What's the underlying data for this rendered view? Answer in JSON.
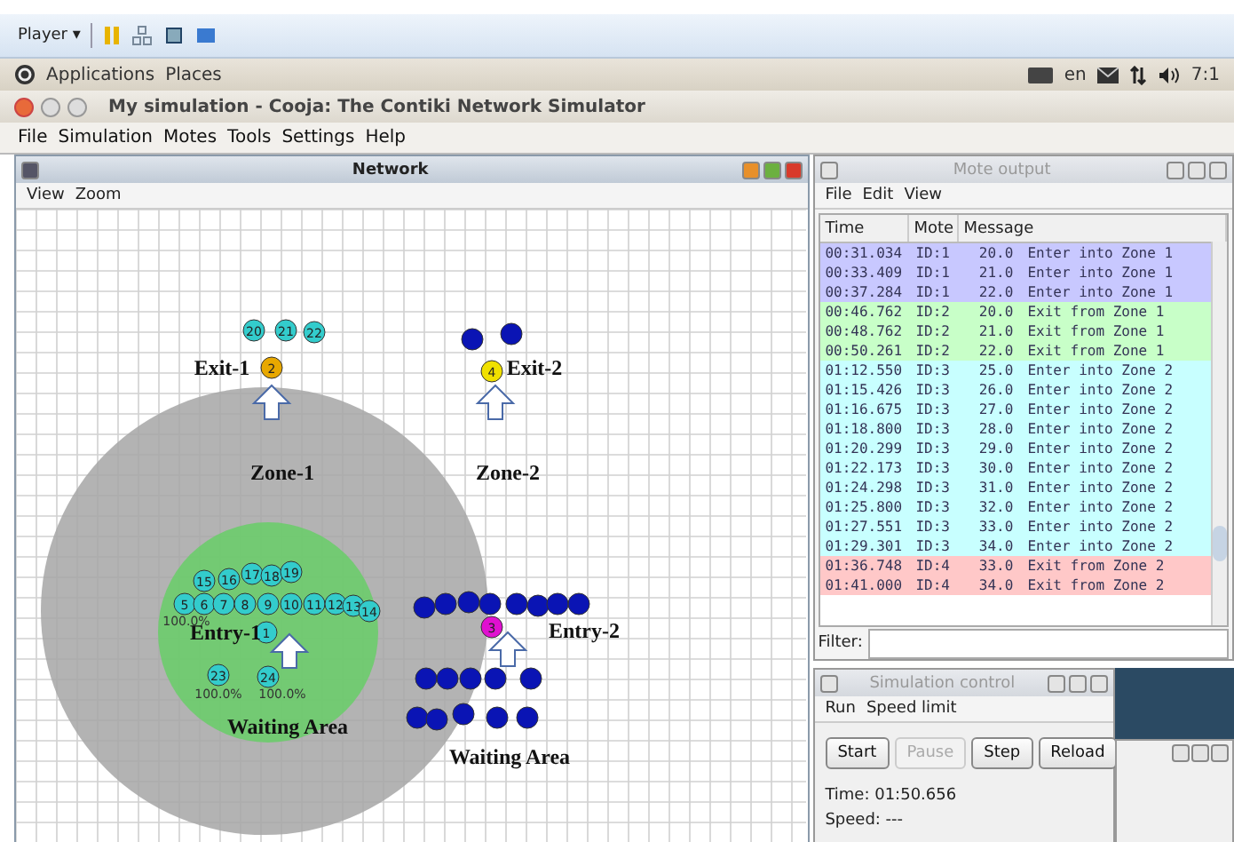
{
  "player_bar": {
    "label": "Player",
    "caret": "▾"
  },
  "panel": {
    "menus": [
      "Applications",
      "Places"
    ],
    "language": "en",
    "clock": "7:1"
  },
  "window": {
    "title": "My simulation - Cooja: The Contiki Network Simulator"
  },
  "menu": [
    "File",
    "Simulation",
    "Motes",
    "Tools",
    "Settings",
    "Help"
  ],
  "network": {
    "title": "Network",
    "menu": [
      "View",
      "Zoom"
    ],
    "motes": [
      {
        "label": "20",
        "color": "#33cccc"
      },
      {
        "label": "21",
        "color": "#33cccc"
      },
      {
        "label": "22",
        "color": "#33cccc"
      },
      {
        "label": "2",
        "color": "#e8a800"
      },
      {
        "color": "#0a14b4"
      },
      {
        "color": "#0a14b4"
      },
      {
        "label": "4",
        "color": "#f0e000"
      },
      {
        "label": "15",
        "color": "#33cccc"
      },
      {
        "label": "16",
        "color": "#33cccc"
      },
      {
        "label": "17",
        "color": "#33cccc"
      },
      {
        "label": "18",
        "color": "#33cccc"
      },
      {
        "label": "19",
        "color": "#33cccc"
      },
      {
        "label": "5",
        "color": "#33cccc"
      },
      {
        "label": "6",
        "color": "#33cccc"
      },
      {
        "label": "7",
        "color": "#33cccc"
      },
      {
        "label": "8",
        "color": "#33cccc"
      },
      {
        "label": "9",
        "color": "#33cccc"
      },
      {
        "label": "10",
        "color": "#33cccc"
      },
      {
        "label": "11",
        "color": "#33cccc"
      },
      {
        "label": "12",
        "color": "#33cccc"
      },
      {
        "label": "13",
        "color": "#33cccc"
      },
      {
        "label": "14",
        "color": "#33cccc"
      },
      {
        "label": "1",
        "color": "#33cccc"
      },
      {
        "label": "23",
        "color": "#33cccc"
      },
      {
        "label": "24",
        "color": "#33cccc"
      },
      {
        "color": "#0a14b4"
      },
      {
        "color": "#0a14b4"
      },
      {
        "color": "#0a14b4"
      },
      {
        "color": "#0a14b4"
      },
      {
        "color": "#0a14b4"
      },
      {
        "color": "#0a14b4"
      },
      {
        "color": "#0a14b4"
      },
      {
        "color": "#0a14b4"
      },
      {
        "label": "3",
        "color": "#e010d0"
      },
      {
        "color": "#0a14b4"
      },
      {
        "color": "#0a14b4"
      },
      {
        "color": "#0a14b4"
      },
      {
        "color": "#0a14b4"
      },
      {
        "color": "#0a14b4"
      },
      {
        "color": "#0a14b4"
      },
      {
        "color": "#0a14b4"
      },
      {
        "color": "#0a14b4"
      },
      {
        "color": "#0a14b4"
      },
      {
        "color": "#0a14b4"
      }
    ],
    "labels": [
      "Exit-1",
      "Exit-2",
      "Zone-1",
      "Zone-2",
      "Entry-1",
      "Entry-2",
      "Waiting Area",
      "Waiting Area"
    ],
    "readings": [
      "100.0%",
      "100.0%",
      "100.0%"
    ]
  },
  "mote_output": {
    "title": "Mote output",
    "menu": [
      "File",
      "Edit",
      "View"
    ],
    "columns": [
      "Time",
      "Mote",
      "Message"
    ],
    "rows": [
      {
        "time": "00:31.034",
        "mote": "ID:1",
        "value": "20.0",
        "message": "Enter into Zone 1",
        "color": "#c8c8ff"
      },
      {
        "time": "00:33.409",
        "mote": "ID:1",
        "value": "21.0",
        "message": "Enter into Zone 1",
        "color": "#c8c8ff"
      },
      {
        "time": "00:37.284",
        "mote": "ID:1",
        "value": "22.0",
        "message": "Enter into Zone 1",
        "color": "#c8c8ff"
      },
      {
        "time": "00:46.762",
        "mote": "ID:2",
        "value": "20.0",
        "message": "Exit from Zone 1",
        "color": "#c8ffc8"
      },
      {
        "time": "00:48.762",
        "mote": "ID:2",
        "value": "21.0",
        "message": "Exit from Zone 1",
        "color": "#c8ffc8"
      },
      {
        "time": "00:50.261",
        "mote": "ID:2",
        "value": "22.0",
        "message": "Exit from Zone 1",
        "color": "#c8ffc8"
      },
      {
        "time": "01:12.550",
        "mote": "ID:3",
        "value": "25.0",
        "message": "Enter into Zone 2",
        "color": "#c8ffff"
      },
      {
        "time": "01:15.426",
        "mote": "ID:3",
        "value": "26.0",
        "message": "Enter into Zone 2",
        "color": "#c8ffff"
      },
      {
        "time": "01:16.675",
        "mote": "ID:3",
        "value": "27.0",
        "message": "Enter into Zone 2",
        "color": "#c8ffff"
      },
      {
        "time": "01:18.800",
        "mote": "ID:3",
        "value": "28.0",
        "message": "Enter into Zone 2",
        "color": "#c8ffff"
      },
      {
        "time": "01:20.299",
        "mote": "ID:3",
        "value": "29.0",
        "message": "Enter into Zone 2",
        "color": "#c8ffff"
      },
      {
        "time": "01:22.173",
        "mote": "ID:3",
        "value": "30.0",
        "message": "Enter into Zone 2",
        "color": "#c8ffff"
      },
      {
        "time": "01:24.298",
        "mote": "ID:3",
        "value": "31.0",
        "message": "Enter into Zone 2",
        "color": "#c8ffff"
      },
      {
        "time": "01:25.800",
        "mote": "ID:3",
        "value": "32.0",
        "message": "Enter into Zone 2",
        "color": "#c8ffff"
      },
      {
        "time": "01:27.551",
        "mote": "ID:3",
        "value": "33.0",
        "message": "Enter into Zone 2",
        "color": "#c8ffff"
      },
      {
        "time": "01:29.301",
        "mote": "ID:3",
        "value": "34.0",
        "message": "Enter into Zone 2",
        "color": "#c8ffff"
      },
      {
        "time": "01:36.748",
        "mote": "ID:4",
        "value": "33.0",
        "message": "Exit from Zone 2",
        "color": "#ffc8c8"
      },
      {
        "time": "01:41.000",
        "mote": "ID:4",
        "value": "34.0",
        "message": "Exit from Zone 2",
        "color": "#ffc8c8"
      }
    ],
    "filter": {
      "label": "Filter:"
    }
  },
  "simulation_control": {
    "title": "Simulation control",
    "menu": [
      "Run",
      "Speed limit"
    ],
    "buttons": [
      {
        "label": "Start",
        "disabled": false
      },
      {
        "label": "Pause",
        "disabled": true
      },
      {
        "label": "Step",
        "disabled": false
      },
      {
        "label": "Reload",
        "disabled": false
      }
    ],
    "time": "Time: 01:50.656",
    "speed": "Speed: ---"
  }
}
